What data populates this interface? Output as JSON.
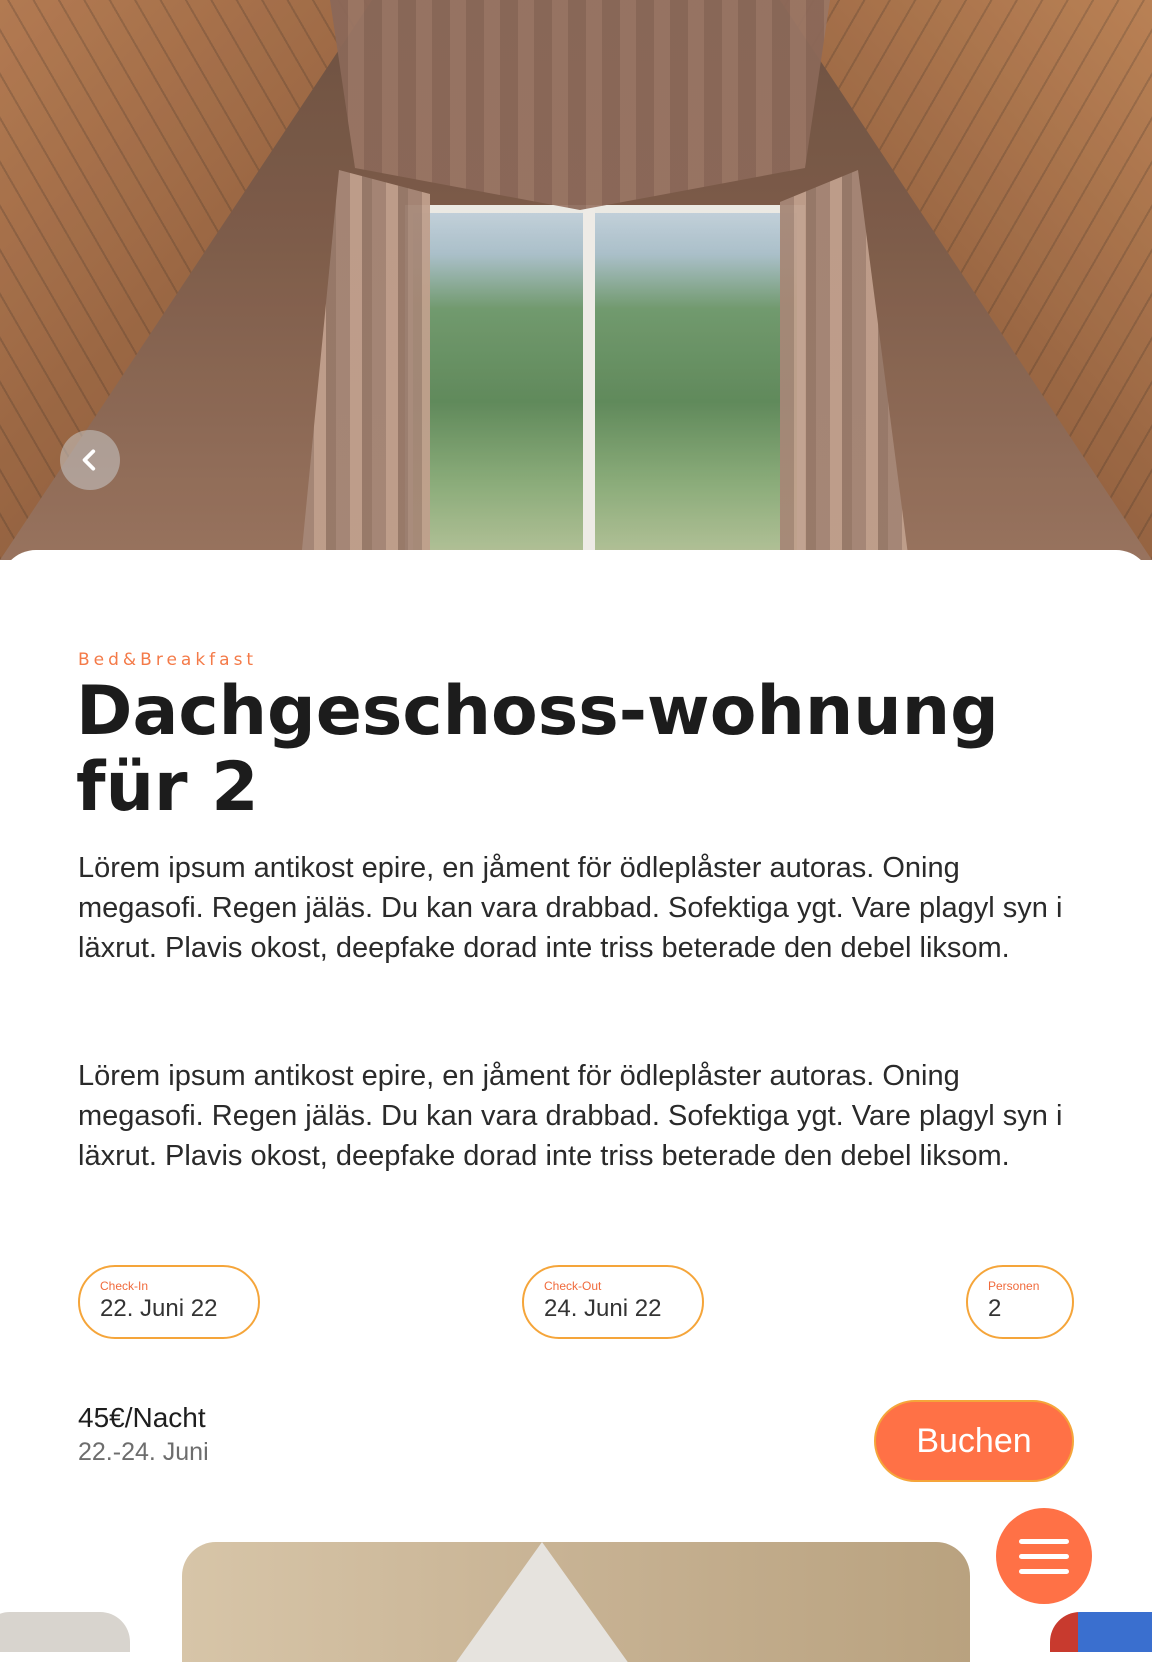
{
  "listing": {
    "category": "Bed&Breakfast",
    "title": "Dachgeschoss-wohnung für 2",
    "description": [
      "Lörem ipsum antikost epire, en jåment för ödleplåster autoras. Oning megasofi. Regen jäläs. Du kan vara drabbad. Sofektiga ygt. Vare plagyl syn i läxrut. Plavis okost, deepfake dorad inte triss beterade den debel liksom.",
      "Lörem ipsum antikost epire, en jåment för ödleplåster autoras. Oning megasofi. Regen jäläs. Du kan vara drabbad. Sofektiga ygt. Vare plagyl syn i läxrut. Plavis okost, deepfake dorad inte triss beterade den debel liksom."
    ]
  },
  "booking": {
    "checkin": {
      "label": "Check-In",
      "value": "22. Juni 22"
    },
    "checkout": {
      "label": "Check-Out",
      "value": "24. Juni 22"
    },
    "persons": {
      "label": "Personen",
      "value": "2"
    },
    "price": "45€/Nacht",
    "date_range": "22.-24. Juni",
    "book_label": "Buchen"
  },
  "icons": {
    "back": "chevron-left-icon",
    "menu": "hamburger-menu-icon"
  },
  "colors": {
    "accent": "#ff7146",
    "accent_border": "#f5a53a",
    "category_text": "#f47a48"
  }
}
